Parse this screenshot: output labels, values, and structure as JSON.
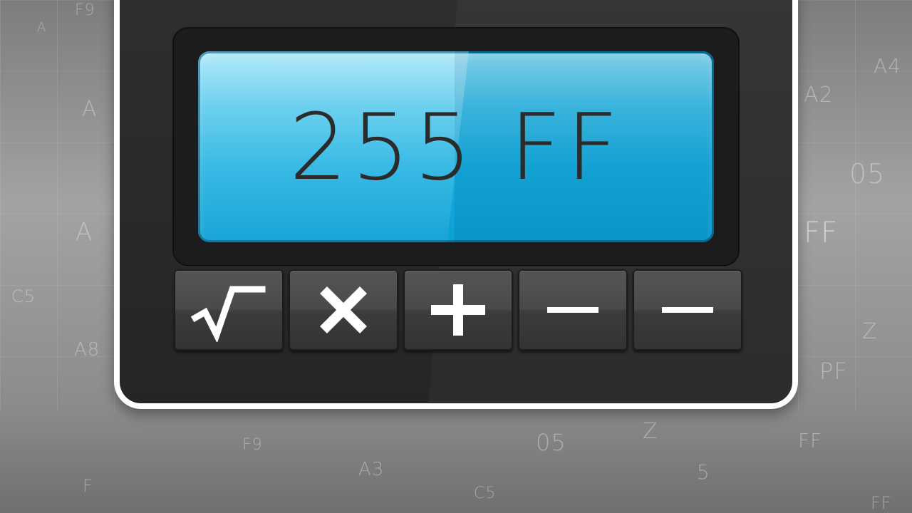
{
  "display": {
    "readout": "255 FF"
  },
  "keys": [
    {
      "symbol": "square-root-icon"
    },
    {
      "symbol": "multiply-icon"
    },
    {
      "symbol": "plus-icon"
    },
    {
      "symbol": "minus-icon"
    },
    {
      "symbol": "minus-icon"
    }
  ],
  "background_glyphs": [
    "F9",
    "A",
    "A",
    "A",
    "A8",
    "C5",
    "A4",
    "A2",
    "05",
    "FF",
    "Z",
    "PF",
    "F9",
    "A3",
    "C5",
    "05",
    "Z",
    "5",
    "FF",
    "F",
    "FF"
  ],
  "colors": {
    "lcd": "#16aee0",
    "indicator": "#11b3dc",
    "indicator_led": "#e8148c",
    "body": "#2a2a2a",
    "key": "#4a4a4a",
    "key_symbol": "#ffffff"
  }
}
